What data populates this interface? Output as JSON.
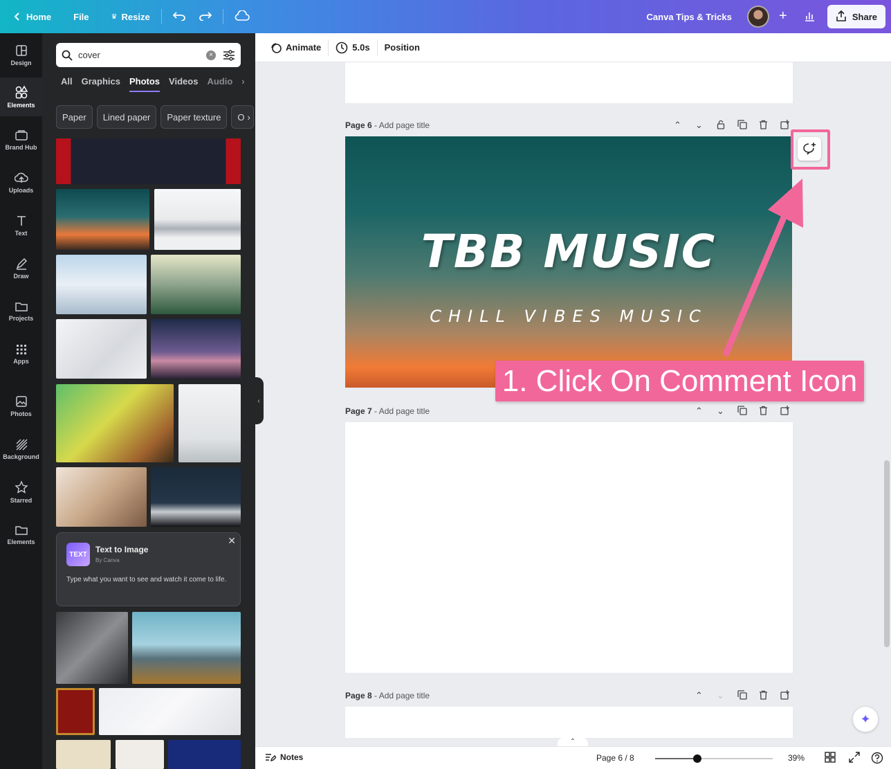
{
  "topbar": {
    "home": "Home",
    "file": "File",
    "resize": "Resize",
    "design_title": "Canva Tips & Tricks",
    "share": "Share"
  },
  "rail": [
    {
      "label": "Design",
      "icon": "layout-icon"
    },
    {
      "label": "Elements",
      "icon": "shapes-icon"
    },
    {
      "label": "Brand Hub",
      "icon": "brand-icon"
    },
    {
      "label": "Uploads",
      "icon": "cloud-upload-icon"
    },
    {
      "label": "Text",
      "icon": "text-icon"
    },
    {
      "label": "Draw",
      "icon": "pen-icon"
    },
    {
      "label": "Projects",
      "icon": "folder-icon"
    },
    {
      "label": "Apps",
      "icon": "grid-icon"
    },
    {
      "label": "Photos",
      "icon": "image-icon"
    },
    {
      "label": "Background",
      "icon": "hatch-icon"
    },
    {
      "label": "Starred",
      "icon": "star-icon"
    },
    {
      "label": "Elements",
      "icon": "folder-icon"
    }
  ],
  "panel": {
    "search_value": "cover",
    "tabs": [
      "All",
      "Graphics",
      "Photos",
      "Videos",
      "Audio"
    ],
    "active_tab": "Photos",
    "chips": [
      "Paper",
      "Lined paper",
      "Paper texture",
      "O"
    ],
    "tti": {
      "icon_text": "TEXT",
      "title": "Text to Image",
      "by": "By Canva",
      "desc": "Type what you want to see and watch it come to life."
    }
  },
  "toolbar": {
    "animate": "Animate",
    "duration": "5.0s",
    "position": "Position"
  },
  "pages": {
    "p6": {
      "num": "Page 6",
      "title": "- Add page title"
    },
    "p7": {
      "num": "Page 7",
      "title": "- Add page title"
    },
    "p8": {
      "num": "Page 8",
      "title": "- Add page title"
    }
  },
  "design": {
    "title": "TBB MUSIC",
    "subtitle": "CHILL VIBES MUSIC"
  },
  "callout": "1. Click On Comment Icon",
  "footer": {
    "notes": "Notes",
    "page_indicator": "Page 6 / 8",
    "zoom": "39%",
    "zoom_fraction": 0.36
  },
  "colors": {
    "accent_pink": "#f2679a",
    "topbar_start": "#12b6c6",
    "topbar_end": "#7a55dd",
    "panel_bg": "#252627"
  }
}
